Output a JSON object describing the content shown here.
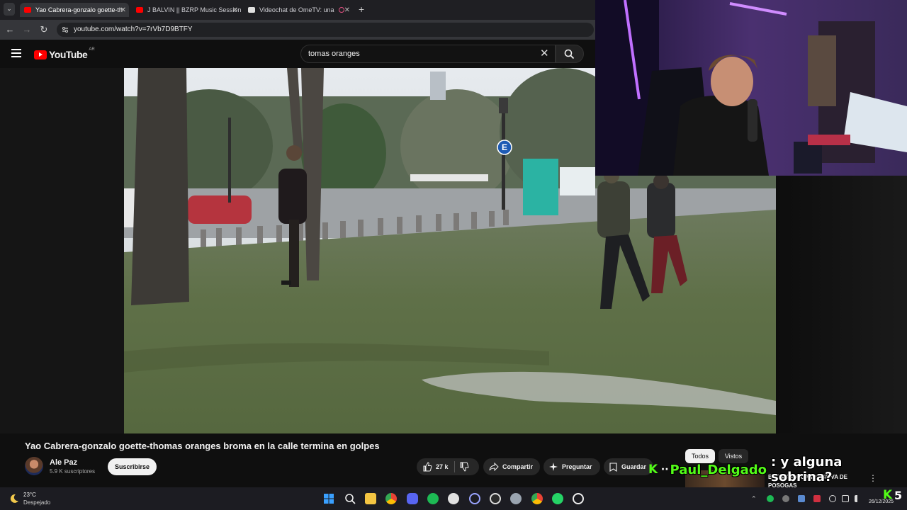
{
  "browser": {
    "tabs": [
      {
        "label": "Yao Cabrera-gonzalo goette-th",
        "active": true,
        "favicon_color": "#ff0000"
      },
      {
        "label": "J BALVIN || BZRP Music Session",
        "active": false,
        "favicon_color": "#ff0000"
      },
      {
        "label": "Videochat de OmeTV: una",
        "active": false,
        "favicon_color": "#e0e0e0"
      }
    ],
    "new_tab_label": "+",
    "url": "youtube.com/watch?v=7rVb7D9BTFY"
  },
  "youtube": {
    "logo_text": "YouTube",
    "country_code": "AR",
    "search_value": "tomas oranges",
    "brand_color": "#ff0000"
  },
  "video": {
    "title": "Yao Cabrera-gonzalo goette-thomas oranges broma en la calle termina en golpes",
    "channel_name": "Ale Paz",
    "subscribers": "5.9 K suscriptores",
    "subscribe_label": "Suscribirse",
    "likes": "27 k",
    "share_label": "Compartir",
    "ask_label": "Preguntar",
    "save_label": "Guardar",
    "scene_sign_letter": "E"
  },
  "sidebar": {
    "chips": [
      "Todos",
      "Vistos"
    ],
    "rec_title": "BROMA A GUANPA SE VA DE POSOGAS"
  },
  "chat_overlay": {
    "username": "Paul_Delgado",
    "message": ": y alguna sobrina?",
    "separator": "··",
    "accent": "#53fc18"
  },
  "taskbar": {
    "temperature": "23°C",
    "weather": "Despejado",
    "date": "26/12/2025",
    "kick_count": "5"
  }
}
